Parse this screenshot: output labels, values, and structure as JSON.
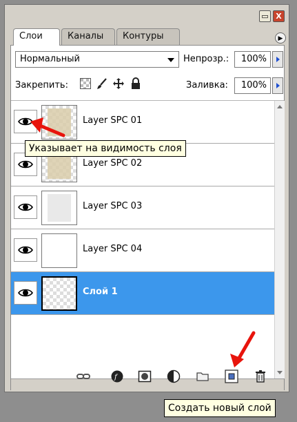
{
  "window": {
    "minimize_label": "▭",
    "close_label": "X"
  },
  "tabs": [
    {
      "label": "Слои",
      "active": true
    },
    {
      "label": "Каналы",
      "active": false
    },
    {
      "label": "Контуры",
      "active": false
    }
  ],
  "panel_menu_icon": "panel-menu-icon",
  "blend_mode": {
    "value": "Нормальный"
  },
  "opacity": {
    "label": "Непрозр.:",
    "value": "100%"
  },
  "lock": {
    "label": "Закрепить:",
    "icons": [
      "lock-transparent-icon",
      "lock-brush-icon",
      "lock-move-icon",
      "lock-all-icon"
    ]
  },
  "fill": {
    "label": "Заливка:",
    "value": "100%"
  },
  "layers": [
    {
      "name": "Layer SPC 01",
      "visible": true,
      "selected": false
    },
    {
      "name": "Layer SPC 02",
      "visible": true,
      "selected": false
    },
    {
      "name": "Layer SPC 03",
      "visible": true,
      "selected": false
    },
    {
      "name": "Layer SPC 04",
      "visible": true,
      "selected": false
    },
    {
      "name": "Слой 1",
      "visible": true,
      "selected": true
    }
  ],
  "bottom_icons": [
    "link-icon",
    "fx-icon",
    "mask-icon",
    "adjustment-icon",
    "folder-icon",
    "new-layer-icon",
    "trash-icon"
  ],
  "annotations": {
    "visibility_tooltip": "Указывает на видимость слоя",
    "new_layer_tooltip": "Создать новый слой",
    "arrow_color": "#e8140c"
  },
  "colors": {
    "selection": "#3c97ec",
    "panel": "#d4d0c8",
    "background": "#8e8e8e"
  }
}
